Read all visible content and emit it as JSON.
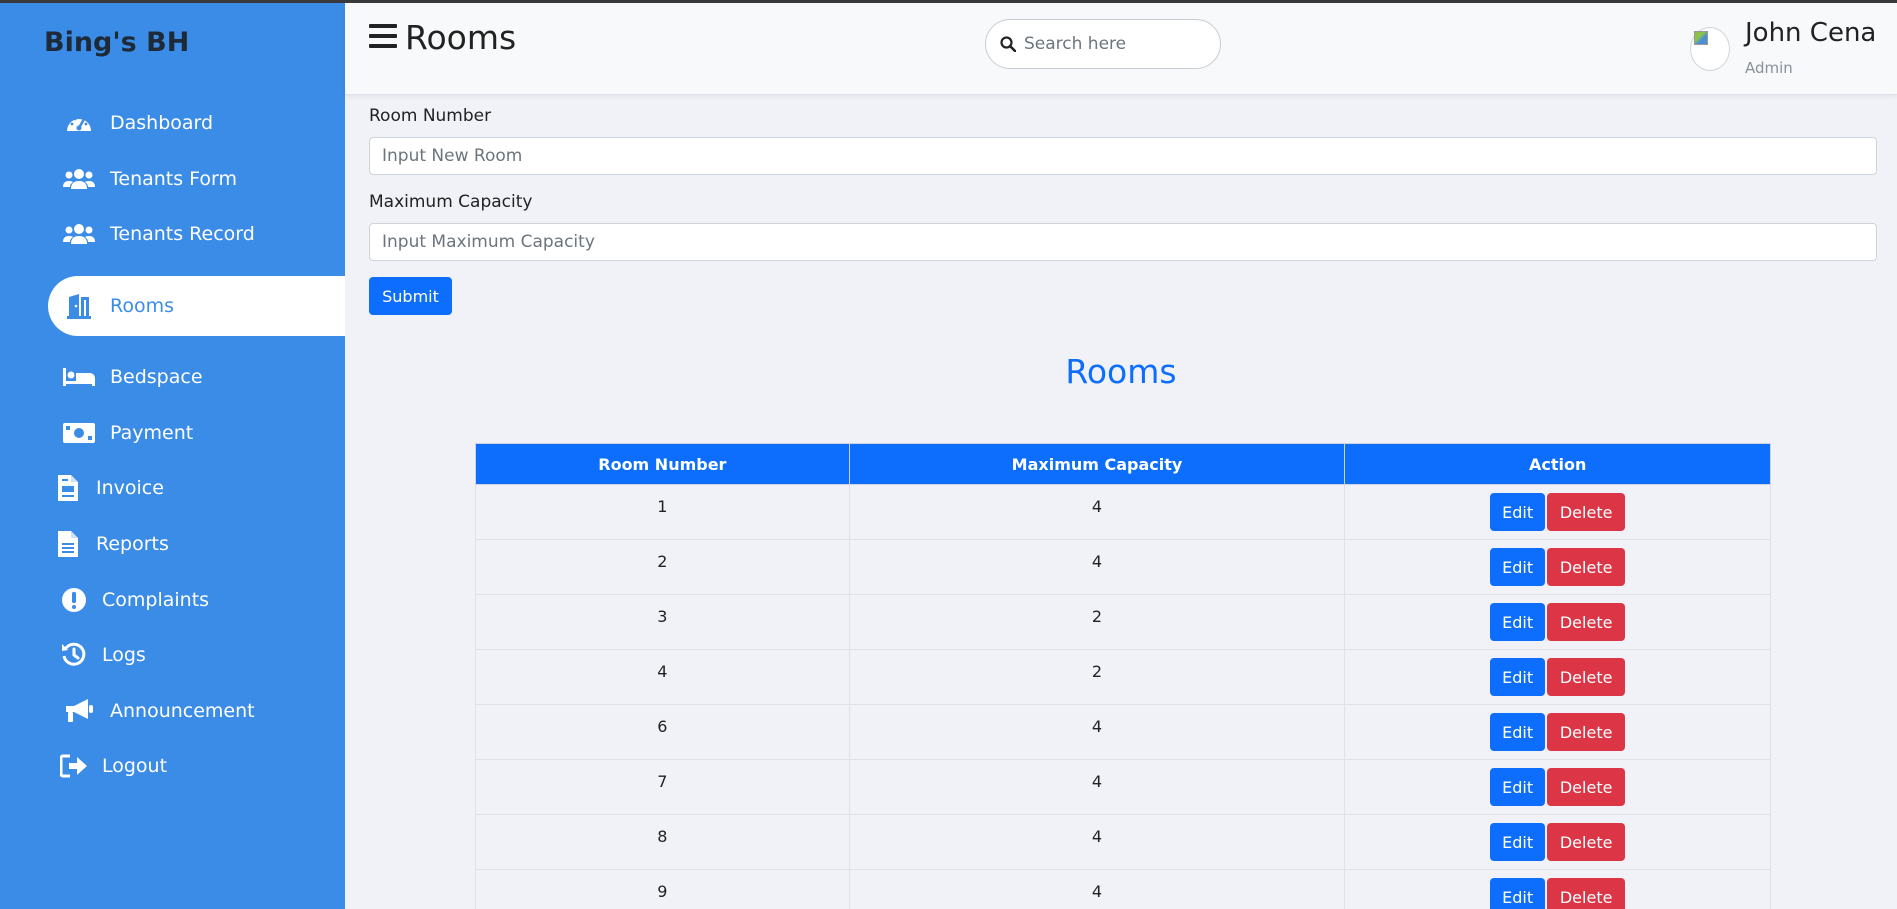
{
  "sidebar": {
    "brand": "Bing's BH",
    "items": [
      {
        "label": "Dashboard"
      },
      {
        "label": "Tenants Form"
      },
      {
        "label": "Tenants Record"
      },
      {
        "label": "Rooms"
      },
      {
        "label": "Bedspace"
      },
      {
        "label": "Payment"
      },
      {
        "label": "Invoice"
      },
      {
        "label": "Reports"
      },
      {
        "label": "Complaints"
      },
      {
        "label": "Logs"
      },
      {
        "label": "Announcement"
      },
      {
        "label": "Logout"
      }
    ],
    "active": "Rooms"
  },
  "header": {
    "title": "Rooms",
    "search_placeholder": "Search here",
    "user_name": "John Cena",
    "user_role": "Admin"
  },
  "form": {
    "room_label": "Room Number",
    "room_placeholder": "Input New Room",
    "capacity_label": "Maximum Capacity",
    "capacity_placeholder": "Input Maximum Capacity",
    "submit_label": "Submit"
  },
  "table": {
    "heading": "Rooms",
    "columns": [
      "Room Number",
      "Maximum Capacity",
      "Action"
    ],
    "rows": [
      {
        "room": "1",
        "capacity": "4"
      },
      {
        "room": "2",
        "capacity": "4"
      },
      {
        "room": "3",
        "capacity": "2"
      },
      {
        "room": "4",
        "capacity": "2"
      },
      {
        "room": "6",
        "capacity": "4"
      },
      {
        "room": "7",
        "capacity": "4"
      },
      {
        "room": "8",
        "capacity": "4"
      },
      {
        "room": "9",
        "capacity": "4"
      }
    ],
    "edit_label": "Edit",
    "delete_label": "Delete"
  },
  "colors": {
    "sidebar": "#3b8ce6",
    "primary": "#0d6efd",
    "danger": "#dc3545"
  }
}
